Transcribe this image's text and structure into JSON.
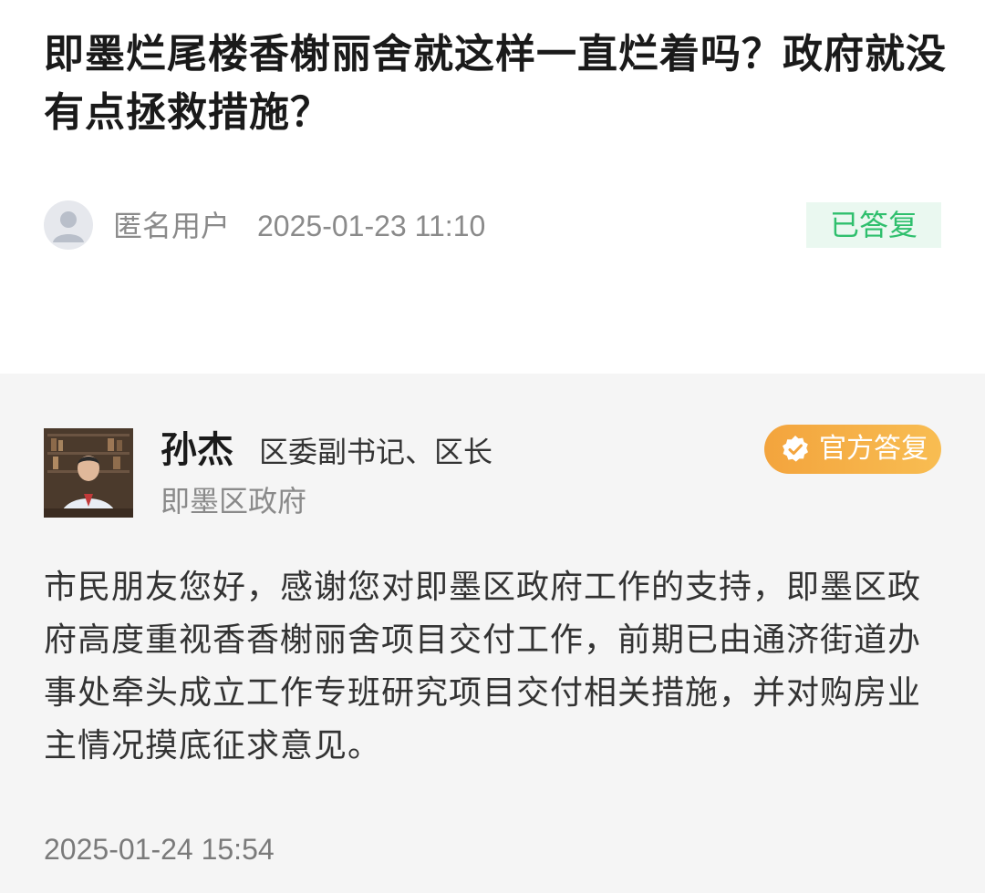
{
  "question": {
    "title": "即墨烂尾楼香榭丽舍就这样一直烂着吗？政府就没有点拯救措施？",
    "asker_name": "匿名用户",
    "asked_at": "2025-01-23 11:10",
    "status": "已答复",
    "status_color": "#2fbf6d",
    "avatar_icon": "user-silhouette-icon"
  },
  "answer": {
    "official_name": "孙杰",
    "official_title": "区委副书记、区长",
    "official_dept": "即墨区政府",
    "badge_label": "官方答复",
    "badge_icon": "verified-check-icon",
    "badge_color": "#f3a43d",
    "reply_text": "市民朋友您好，感谢您对即墨区政府工作的支持，即墨区政府高度重视香香榭丽舍项目交付工作，前期已由通济街道办事处牵头成立工作专班研究项目交付相关措施，并对购房业主情况摸底征求意见。",
    "answered_at": "2025-01-24 15:54"
  }
}
